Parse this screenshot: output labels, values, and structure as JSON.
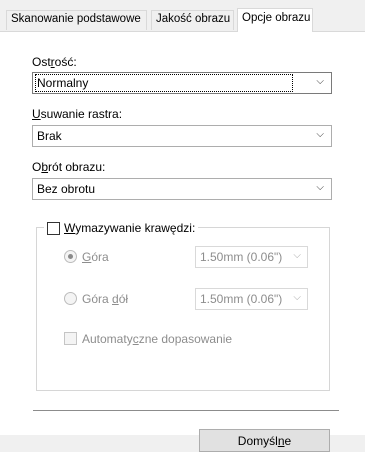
{
  "tabs": [
    {
      "label": "Skanowanie podstawowe"
    },
    {
      "label": "Jakość obrazu"
    },
    {
      "label": "Opcje obrazu"
    }
  ],
  "sharpness": {
    "label_pre": "Ost",
    "label_accel": "r",
    "label_post": "ość:",
    "value": "Normalny"
  },
  "descreen": {
    "label_accel": "U",
    "label_post": "suwanie rastra:",
    "value": "Brak"
  },
  "rotation": {
    "label_pre": "O",
    "label_accel": "b",
    "label_post": "rót obrazu:",
    "value": "Bez obrotu"
  },
  "edge_erase": {
    "label_accel": "W",
    "label_post": "ymazywanie krawędzi:",
    "top": {
      "label_accel": "G",
      "label_post": "óra",
      "value": "1.50mm (0.06\")"
    },
    "top_bottom": {
      "label_pre": "Góra ",
      "label_accel": "d",
      "label_post": "ół",
      "value": "1.50mm (0.06\")"
    },
    "auto": {
      "label_pre": "Automaty",
      "label_accel": "c",
      "label_post": "zne dopasowanie"
    }
  },
  "default_button": {
    "label_pre": "Domyśl",
    "label_accel": "n",
    "label_post": "e"
  }
}
